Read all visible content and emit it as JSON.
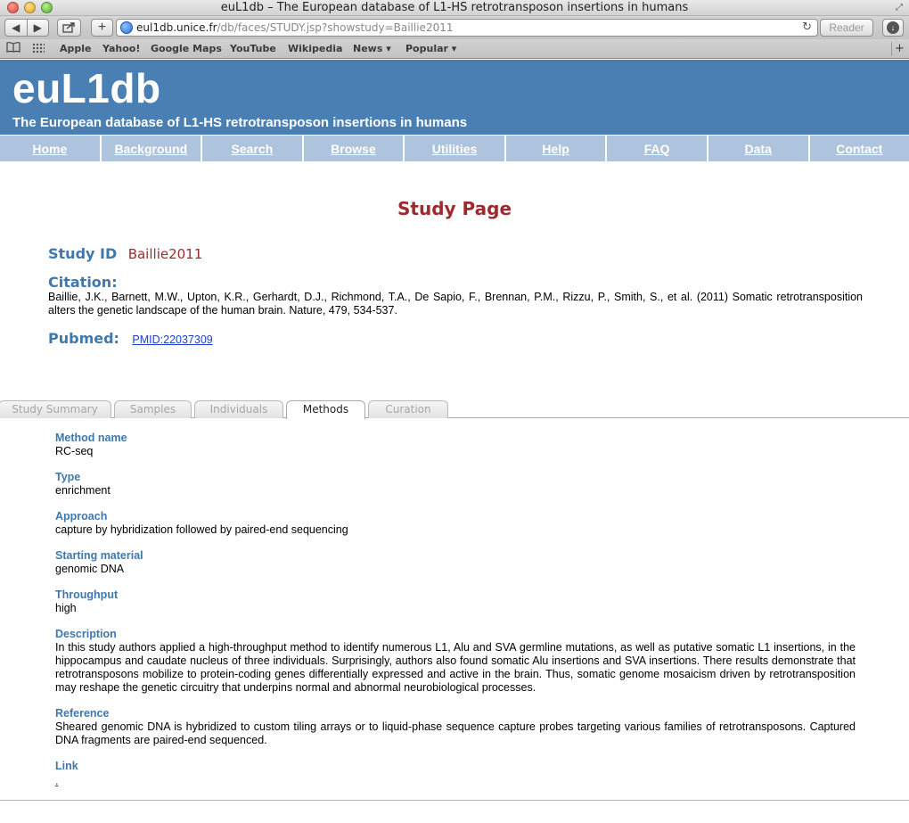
{
  "window": {
    "title": "euL1db – The European database of L1-HS retrotransposon insertions in humans"
  },
  "toolbar": {
    "back_icon": "◀",
    "forward_icon": "▶",
    "plus_icon": "+",
    "url_host": "eul1db.unice.fr",
    "url_path": "/db/faces/STUDY.jsp?showstudy=Baillie2011",
    "reload_icon": "↻",
    "reader_label": "Reader",
    "download_icon": "↓"
  },
  "bookmarks": [
    {
      "label": "Apple"
    },
    {
      "label": "Yahoo!"
    },
    {
      "label": "Google Maps"
    },
    {
      "label": "YouTube"
    },
    {
      "label": "Wikipedia"
    },
    {
      "label": "News ▾"
    },
    {
      "label": "Popular ▾"
    }
  ],
  "site": {
    "logo": "euL1db",
    "tagline": "The European database of L1-HS retrotransposon insertions in humans"
  },
  "nav": [
    {
      "label": "Home"
    },
    {
      "label": "Background"
    },
    {
      "label": "Search"
    },
    {
      "label": "Browse"
    },
    {
      "label": "Utilities"
    },
    {
      "label": "Help"
    },
    {
      "label": "FAQ"
    },
    {
      "label": "Data"
    },
    {
      "label": "Contact"
    }
  ],
  "study": {
    "heading": "Study Page",
    "id_label": "Study ID",
    "id_value": "Baillie2011",
    "citation_label": "Citation:",
    "citation_text": "Baillie, J.K., Barnett, M.W., Upton, K.R., Gerhardt, D.J., Richmond, T.A., De Sapio, F., Brennan, P.M., Rizzu, P., Smith, S., et al. (2011) Somatic retrotransposition alters the genetic landscape of the human brain. Nature, 479, 534-537.",
    "pubmed_label": "Pubmed:",
    "pubmed_link": "PMID:22037309"
  },
  "tabs": [
    {
      "label": "Study Summary",
      "active": false
    },
    {
      "label": "Samples",
      "active": false
    },
    {
      "label": "Individuals",
      "active": false
    },
    {
      "label": "Methods",
      "active": true
    },
    {
      "label": "Curation",
      "active": false
    }
  ],
  "methods": {
    "method_name_label": "Method name",
    "method_name": "RC-seq",
    "type_label": "Type",
    "type": "enrichment",
    "approach_label": "Approach",
    "approach": "capture by hybridization followed by paired-end sequencing",
    "starting_material_label": "Starting material",
    "starting_material": "genomic DNA",
    "throughput_label": "Throughput",
    "throughput": "high",
    "description_label": "Description",
    "description": "In this study authors applied a high-throughput method to identify numerous L1, Alu and SVA germline mutations, as well as putative somatic L1 insertions, in the hippocampus and caudate nucleus of three individuals. Surprisingly, authors also found somatic Alu insertions and SVA insertions. There results demonstrate that retrotransposons mobilize to protein-coding genes differentially expressed and active in the brain. Thus, somatic genome mosaicism driven by retrotransposition may reshape the genetic circuitry that underpins normal and abnormal neurobiological processes.",
    "reference_label": "Reference",
    "reference": "Sheared genomic DNA is hybridized to custom tiling arrays or to liquid-phase sequence capture probes targeting various families of retrotransposons. Captured DNA fragments are paired-end sequenced.",
    "link_label": "Link",
    "link": "."
  },
  "colors": {
    "header_bg": "#4a7fb4",
    "nav_bg": "#aec4dc",
    "heading_red": "#9e2a2e",
    "label_blue": "#3f78ad",
    "link_blue": "#1a3fd1"
  }
}
